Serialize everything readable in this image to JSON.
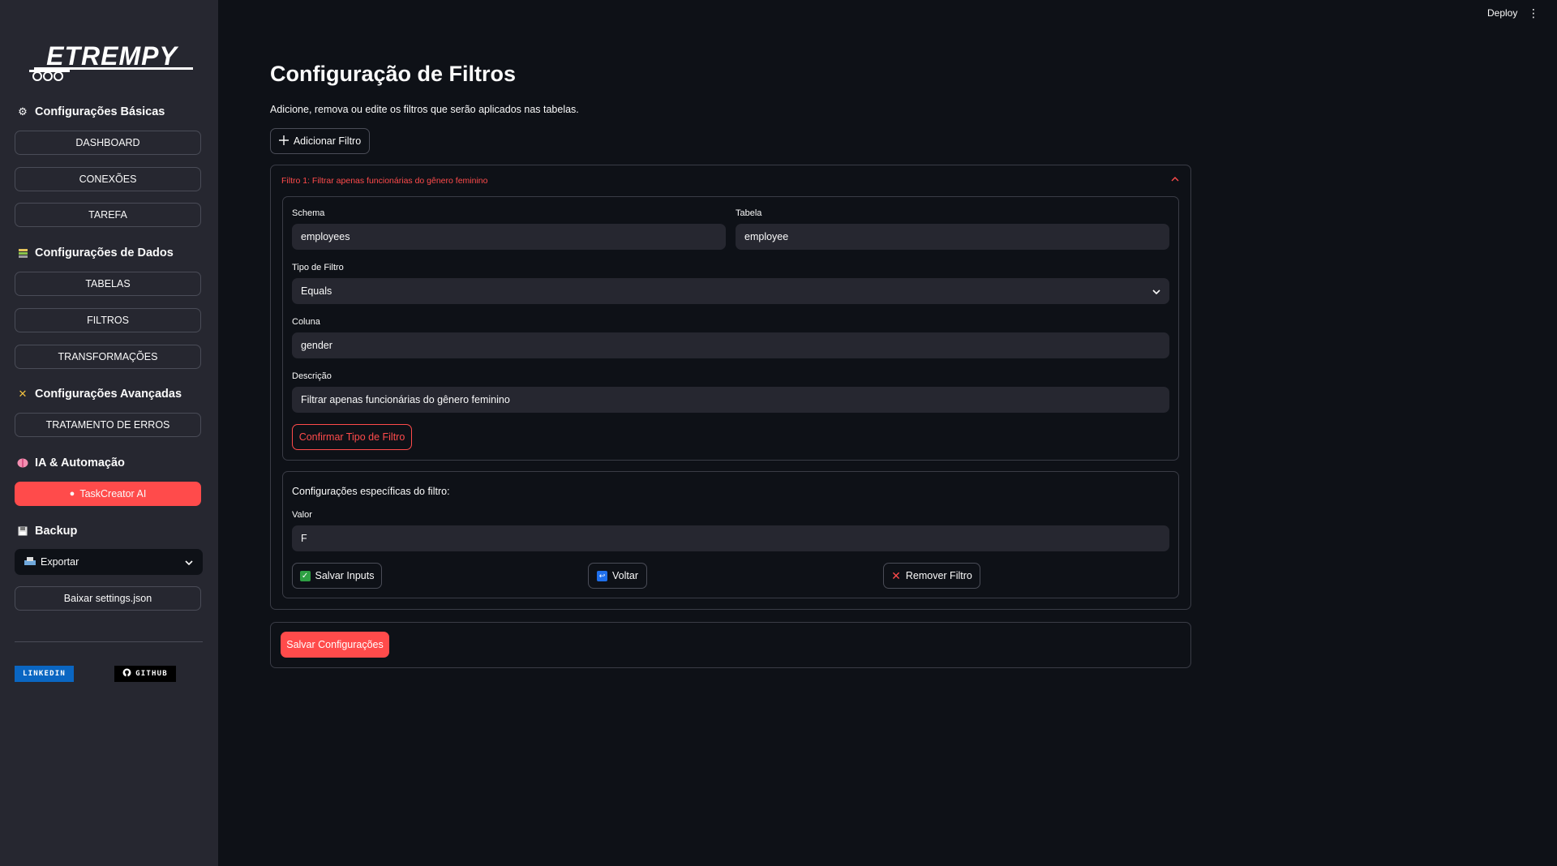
{
  "header": {
    "deploy_label": "Deploy",
    "menu_icon": "kebab-icon"
  },
  "sidebar": {
    "logo_text": "ETREMPY",
    "sections": [
      {
        "title": "Configurações Básicas",
        "icon": "gear-icon"
      },
      {
        "title": "Configurações de Dados",
        "icon": "database-icon"
      },
      {
        "title": "Configurações Avançadas",
        "icon": "tools-icon"
      },
      {
        "title": "IA & Automação",
        "icon": "brain-icon"
      },
      {
        "title": "Backup",
        "icon": "floppy-icon"
      }
    ],
    "buttons": {
      "dashboard": "DASHBOARD",
      "conexoes": "CONEXÕES",
      "tarefa": "TAREFA",
      "tabelas": "TABELAS",
      "filtros": "FILTROS",
      "transformacoes": "TRANSFORMAÇÕES",
      "tratamento": "TRATAMENTO DE ERROS",
      "taskcreator": "TaskCreator AI",
      "baixar": "Baixar settings.json"
    },
    "export_select": {
      "value": "Exportar"
    },
    "badges": {
      "linkedin": "LINKEDIN",
      "github": "GITHUB"
    }
  },
  "main": {
    "title": "Configuração de Filtros",
    "subtitle": "Adicione, remova ou edite os filtros que serão aplicados nas tabelas.",
    "add_button": "Adicionar Filtro",
    "filter": {
      "header": "Filtro 1: Filtrar apenas funcionárias do gênero feminino",
      "schema_label": "Schema",
      "schema_value": "employees",
      "tabela_label": "Tabela",
      "tabela_value": "employee",
      "tipo_label": "Tipo de Filtro",
      "tipo_value": "Equals",
      "coluna_label": "Coluna",
      "coluna_value": "gender",
      "descricao_label": "Descrição",
      "descricao_value": "Filtrar apenas funcionárias do gênero feminino",
      "confirm_button": "Confirmar Tipo de Filtro",
      "specific_title": "Configurações específicas do filtro:",
      "valor_label": "Valor",
      "valor_value": "F",
      "salvar_inputs": "Salvar Inputs",
      "voltar": "Voltar",
      "remover": "Remover Filtro"
    },
    "save_button": "Salvar Configurações"
  },
  "colors": {
    "accent": "#ff4b4b",
    "background": "#0e1117",
    "sidebar": "#262730"
  }
}
